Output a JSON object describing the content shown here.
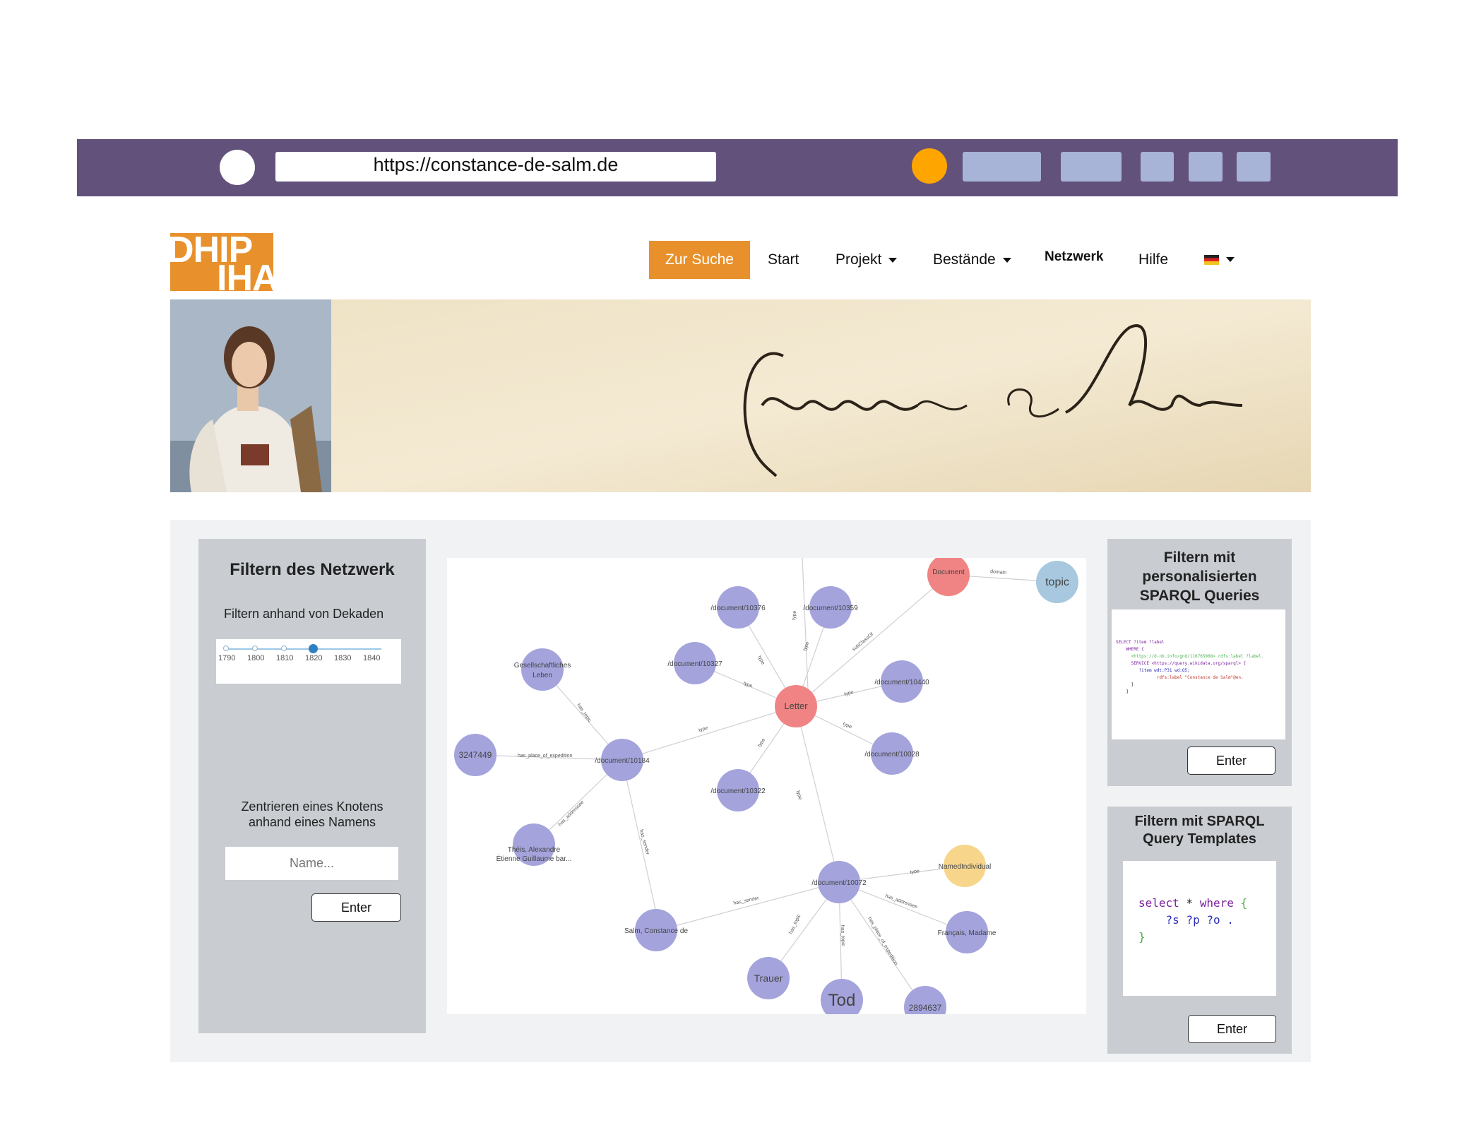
{
  "browser": {
    "url": "https://constance-de-salm.de"
  },
  "logo": {
    "line1": "DHIP",
    "line2": "IHA"
  },
  "nav": {
    "search": "Zur Suche",
    "start": "Start",
    "projekt": "Projekt",
    "bestaende": "Bestände",
    "netzwerk": "Netzwerk",
    "hilfe": "Hilfe",
    "language": "de-flag-icon"
  },
  "banner": {
    "signature": "Constance de Salm"
  },
  "filter_network": {
    "title": "Filtern des Netzwerk",
    "decades_label": "Filtern anhand von Dekaden",
    "decades": [
      "1790",
      "1800",
      "1810",
      "1820",
      "1830",
      "1840"
    ],
    "selected_range": [
      "1790",
      "1820"
    ],
    "center_label_line1": "Zentrieren eines Knotens",
    "center_label_line2": "anhand eines Namens",
    "name_placeholder": "Name...",
    "enter": "Enter"
  },
  "graph": {
    "nodes": [
      {
        "id": "letter",
        "label": "Letter",
        "kind": "class"
      },
      {
        "id": "document",
        "label": "Document",
        "kind": "class"
      },
      {
        "id": "topic",
        "label": "topic",
        "kind": "property"
      },
      {
        "id": "d10376",
        "label": "/document/10376",
        "kind": "instance"
      },
      {
        "id": "d10359",
        "label": "/document/10359",
        "kind": "instance"
      },
      {
        "id": "d10327",
        "label": "/document/10327",
        "kind": "instance"
      },
      {
        "id": "d10440",
        "label": "/document/10440",
        "kind": "instance"
      },
      {
        "id": "d10184",
        "label": "/document/10184",
        "kind": "instance"
      },
      {
        "id": "d10028",
        "label": "/document/10028",
        "kind": "instance"
      },
      {
        "id": "d10322",
        "label": "/document/10322",
        "kind": "instance"
      },
      {
        "id": "d10072",
        "label": "/document/10072",
        "kind": "instance"
      },
      {
        "id": "gesellschaft",
        "label_line1": "Gesellschaftliches",
        "label_line2": "Leben",
        "kind": "instance"
      },
      {
        "id": "n3247449",
        "label": "3247449",
        "kind": "instance"
      },
      {
        "id": "theis",
        "label_line1": "Théis, Alexandre",
        "label_line2": "Étienne Guillaume bar...",
        "kind": "instance"
      },
      {
        "id": "salm",
        "label": "Salm, Constance de",
        "kind": "instance"
      },
      {
        "id": "named",
        "label": "NamedIndividual",
        "kind": "named"
      },
      {
        "id": "francais",
        "label": "Français, Madame",
        "kind": "instance"
      },
      {
        "id": "trauer",
        "label": "Trauer",
        "kind": "instance"
      },
      {
        "id": "tod",
        "label": "Tod",
        "kind": "instance"
      },
      {
        "id": "n2894637",
        "label": "2894637",
        "kind": "instance"
      }
    ],
    "edges": [
      {
        "label": "domain"
      },
      {
        "label": "subClassOf"
      },
      {
        "label": "type"
      },
      {
        "label": "has_topic"
      },
      {
        "label": "has_place_of_expedition"
      },
      {
        "label": "has_addressee"
      },
      {
        "label": "has_sender"
      }
    ],
    "colors": {
      "instance": "#a4a3dc",
      "class": "#f08484",
      "property": "#a7c8de",
      "named": "#f7d68c",
      "edge": "#c8c8d0"
    }
  },
  "sparql_custom": {
    "title_line1": "Filtern mit",
    "title_line2": "personalisierten",
    "title_line3": "SPARQL Queries",
    "code": [
      "SELECT ?item ?label",
      "    WHERE {",
      "      <https://d-nb.info/gnd/116765968> rdfs:label ?label.",
      "",
      "      SERVICE <https://query.wikidata.org/sparql> {",
      "         ?item wdt:P31 wd:Q5;",
      "                rdfs:label \"Constance de Salm\"@en.",
      "      }",
      "    }"
    ],
    "enter": "Enter"
  },
  "sparql_templates": {
    "title_line1": "Filtern mit SPARQL",
    "title_line2": "Query Templates",
    "code_line1_a": "select",
    "code_line1_b": " * ",
    "code_line1_c": "where",
    "code_line1_d": " {",
    "code_line2": "    ?s ?p ?o .",
    "code_line3": "}",
    "enter": "Enter"
  }
}
